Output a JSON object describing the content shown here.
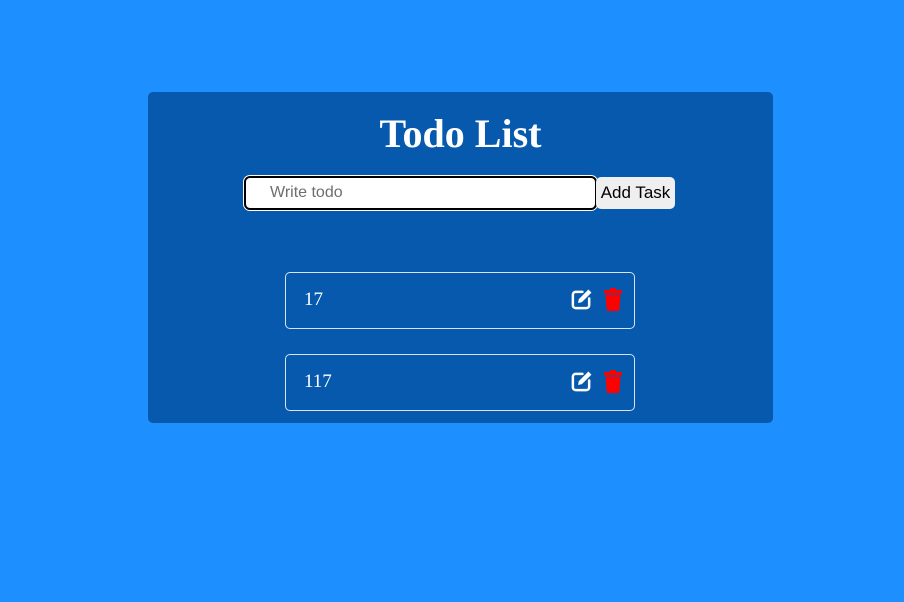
{
  "app": {
    "title": "Todo List"
  },
  "form": {
    "input_placeholder": "Write todo",
    "input_value": "",
    "add_button_label": "Add Task"
  },
  "todos": [
    {
      "text": "17",
      "edit_icon": "edit-icon",
      "delete_icon": "trash-icon"
    },
    {
      "text": "117",
      "edit_icon": "edit-icon",
      "delete_icon": "trash-icon"
    }
  ],
  "colors": {
    "page_background": "#1e8fff",
    "card_background": "#0659ad",
    "delete_icon": "#ff0000",
    "edit_icon": "#ffffff"
  }
}
